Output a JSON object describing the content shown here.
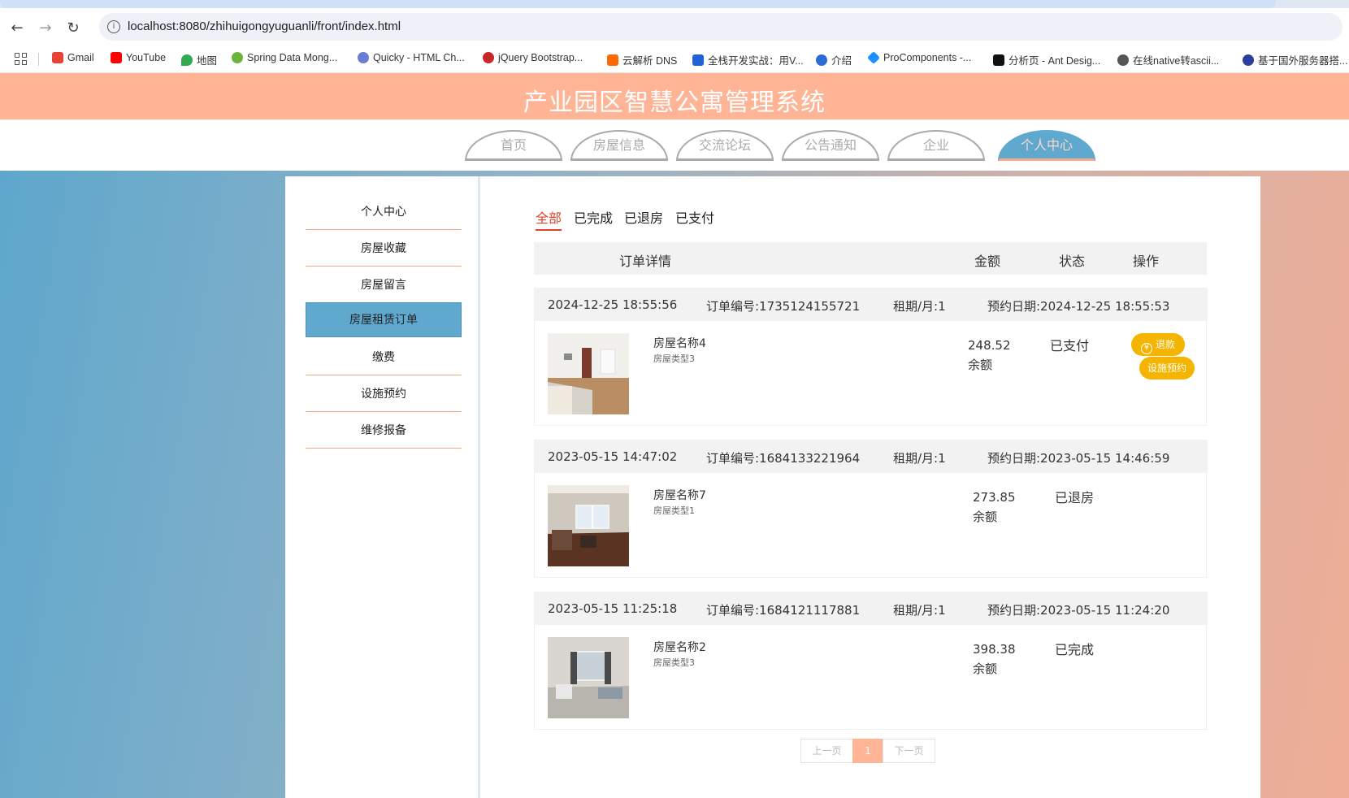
{
  "browser": {
    "url": "localhost:8080/zhihuigongyuguanli/front/index.html",
    "bookmarks": [
      {
        "label": "Gmail",
        "color": "#ea4335"
      },
      {
        "label": "YouTube",
        "color": "#ff0000"
      },
      {
        "label": "地图",
        "color": "#34a853"
      },
      {
        "label": "Spring Data Mong...",
        "color": "#6db33f"
      },
      {
        "label": "Quicky - HTML Ch...",
        "color": "#6c7bd6"
      },
      {
        "label": "jQuery Bootstrap...",
        "color": "#c62828"
      },
      {
        "label": "云解析 DNS",
        "color": "#ff6a00"
      },
      {
        "label": "全栈开发实战：用V...",
        "color": "#1e62d6"
      },
      {
        "label": "介绍",
        "color": "#2b6bd6"
      },
      {
        "label": "ProComponents -...",
        "color": "#1890ff"
      },
      {
        "label": "分析页 - Ant Desig...",
        "color": "#111111"
      },
      {
        "label": "在线native转ascii...",
        "color": "#555555"
      },
      {
        "label": "基于国外服务器搭...",
        "color": "#2c3e9c"
      }
    ]
  },
  "header": {
    "title": "产业园区智慧公寓管理系统",
    "nav": [
      "首页",
      "房屋信息",
      "交流论坛",
      "公告通知",
      "企业",
      "个人中心"
    ]
  },
  "sidebar": {
    "items": [
      "个人中心",
      "房屋收藏",
      "房屋留言",
      "房屋租赁订单",
      "缴费",
      "设施预约",
      "维修报备"
    ]
  },
  "filters": [
    "全部",
    "已完成",
    "已退房",
    "已支付"
  ],
  "table_head": {
    "detail": "订单详情",
    "amount": "金额",
    "status": "状态",
    "action": "操作"
  },
  "orders": [
    {
      "time": "2024-12-25 18:55:56",
      "order_no": "订单编号:1735124155721",
      "period": "租期/月:1",
      "reserve": "预约日期:2024-12-25 18:55:53",
      "name": "房屋名称4",
      "type": "房屋类型3",
      "amount": "248.52",
      "pay": "余额",
      "status": "已支付",
      "refund_label": "退款",
      "facility_label": "设施预约"
    },
    {
      "time": "2023-05-15 14:47:02",
      "order_no": "订单编号:1684133221964",
      "period": "租期/月:1",
      "reserve": "预约日期:2023-05-15 14:46:59",
      "name": "房屋名称7",
      "type": "房屋类型1",
      "amount": "273.85",
      "pay": "余额",
      "status": "已退房"
    },
    {
      "time": "2023-05-15 11:25:18",
      "order_no": "订单编号:1684121117881",
      "period": "租期/月:1",
      "reserve": "预约日期:2023-05-15 11:24:20",
      "name": "房屋名称2",
      "type": "房屋类型3",
      "amount": "398.38",
      "pay": "余额",
      "status": "已完成"
    }
  ],
  "pager": {
    "prev": "上一页",
    "current": "1",
    "next": "下一页"
  },
  "colors": {
    "header_bg": "#ffb496",
    "accent_blue": "#5fa9cf",
    "active_red": "#e0402a",
    "button_yellow": "#f5b400"
  }
}
